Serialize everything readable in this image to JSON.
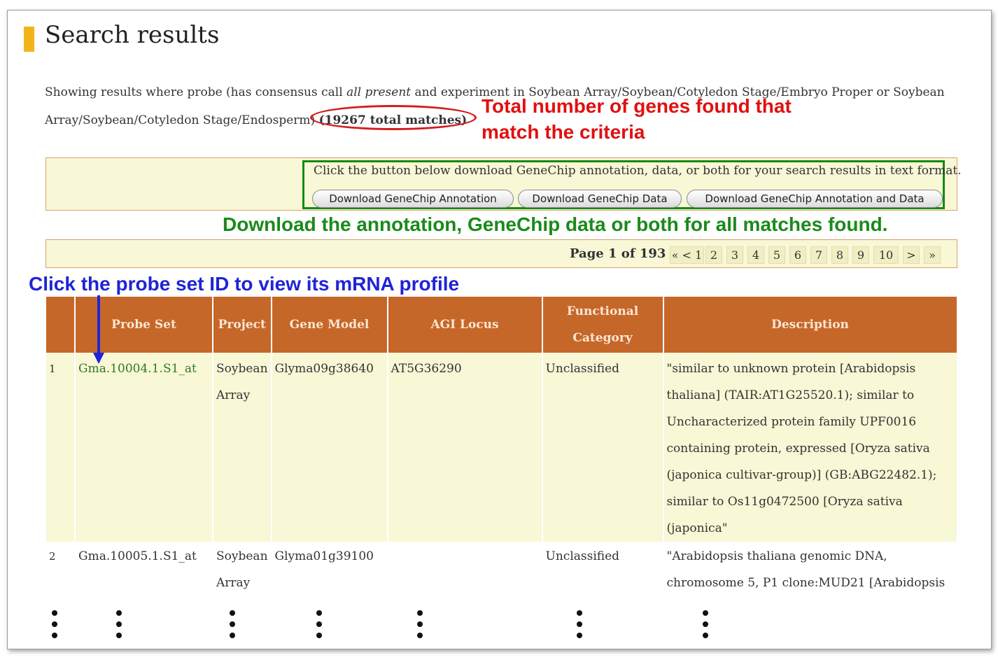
{
  "page": {
    "title": "Search results",
    "summary": {
      "prefix": "Showing results where probe (has consensus call ",
      "call": "all present",
      "middle": " and experiment in Soybean Array/Soybean/Cotyledon Stage/Embryo Proper or Soybean Array/Soybean/Cotyledon Stage/Endosperm) ",
      "total": "(19267 total matches)"
    }
  },
  "annotations": {
    "total_line1": "Total number of genes found that",
    "total_line2": "match the criteria",
    "download": "Download the annotation, GeneChip data or both for all matches found.",
    "probe": "Click the probe set ID to view its mRNA profile"
  },
  "download": {
    "text": "Click the button below download GeneChip annotation, data, or both for your search results in text format.",
    "buttons": {
      "annotation": "Download GeneChip Annotation",
      "data": "Download GeneChip Data",
      "both": "Download GeneChip Annotation and Data"
    }
  },
  "pager": {
    "label": "Page 1 of 193",
    "links": [
      "« < 1",
      "2",
      "3",
      "4",
      "5",
      "6",
      "7",
      "8",
      "9",
      "10",
      ">",
      "»"
    ]
  },
  "table": {
    "headers": [
      "",
      "Probe Set",
      "Project",
      "Gene Model",
      "AGI Locus",
      "Functional Category",
      "Description"
    ],
    "rows": [
      {
        "n": "1",
        "probe": "Gma.10004.1.S1_at",
        "project": "Soybean Array",
        "gene_model": "Glyma09g38640",
        "agi": "AT5G36290",
        "category": "Unclassified",
        "description": "\"similar to unknown protein [Arabidopsis thaliana] (TAIR:AT1G25520.1); similar to Uncharacterized protein family UPF0016 containing protein, expressed [Oryza sativa (japonica cultivar-group)] (GB:ABG22482.1); similar to Os11g0472500 [Oryza sativa (japonica\""
      },
      {
        "n": "2",
        "probe": "Gma.10005.1.S1_at",
        "project": "Soybean Array",
        "gene_model": "Glyma01g39100",
        "agi": "",
        "category": "Unclassified",
        "description": "\"Arabidopsis thaliana genomic DNA, chromosome 5, P1 clone:MUD21 [Arabidopsis"
      }
    ]
  }
}
